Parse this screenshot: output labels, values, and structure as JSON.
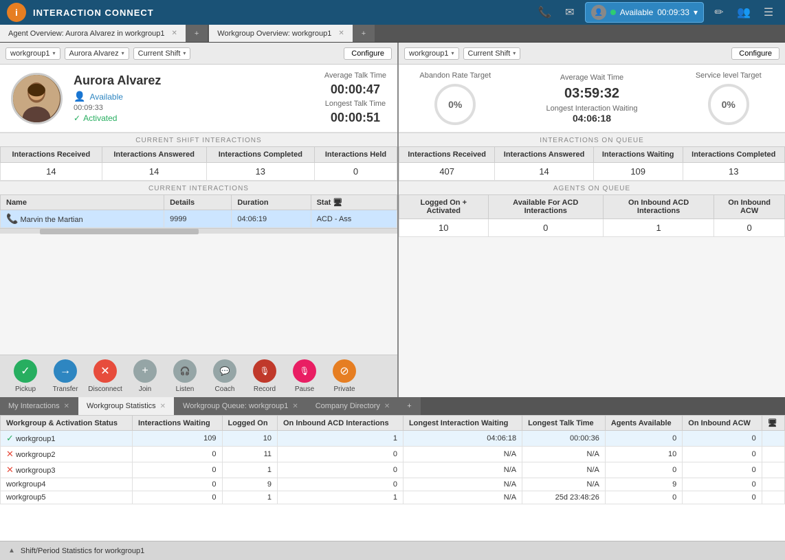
{
  "app": {
    "title": "INTERACTION CONNECT",
    "logo_char": "i"
  },
  "topnav": {
    "status": "Available",
    "timer": "00:09:33",
    "status_color": "#2ecc71"
  },
  "left_panel": {
    "tab_label": "Agent Overview: Aurora Alvarez in workgroup1",
    "workgroup_dropdown": "workgroup1",
    "agent_dropdown": "Aurora Alvarez",
    "period_dropdown": "Current Shift",
    "configure_label": "Configure",
    "agent": {
      "name": "Aurora Alvarez",
      "status": "Available",
      "time": "00:09:33",
      "activated": "Activated"
    },
    "avg_talk_label": "Average Talk Time",
    "avg_talk_value": "00:00:47",
    "longest_talk_label": "Longest Talk Time",
    "longest_talk_value": "00:00:51",
    "shift_section": "CURRENT SHIFT INTERACTIONS",
    "shift_stats": {
      "headers": [
        "Interactions Received",
        "Interactions Answered",
        "Interactions Completed",
        "Interactions Held"
      ],
      "values": [
        "14",
        "14",
        "13",
        "0"
      ]
    },
    "current_section": "CURRENT INTERACTIONS",
    "interactions_headers": [
      "Name",
      "Details",
      "Duration",
      "Stat"
    ],
    "interactions_rows": [
      {
        "name": "Marvin the Martian",
        "details": "9999",
        "duration": "04:06:19",
        "status": "ACD - Ass"
      }
    ],
    "actions": [
      {
        "id": "pickup",
        "label": "Pickup",
        "style": "btn-green",
        "icon": "✓"
      },
      {
        "id": "transfer",
        "label": "Transfer",
        "style": "btn-blue",
        "icon": "→"
      },
      {
        "id": "disconnect",
        "label": "Disconnect",
        "style": "btn-red",
        "icon": "✕"
      },
      {
        "id": "join",
        "label": "Join",
        "style": "btn-gray",
        "icon": "+"
      },
      {
        "id": "listen",
        "label": "Listen",
        "style": "btn-gray",
        "icon": "🎧"
      },
      {
        "id": "coach",
        "label": "Coach",
        "style": "btn-gray",
        "icon": "💬"
      },
      {
        "id": "record",
        "label": "Record",
        "style": "btn-dark-red",
        "icon": "🎙"
      },
      {
        "id": "pause",
        "label": "Pause",
        "style": "btn-pink",
        "icon": "🎙"
      },
      {
        "id": "private",
        "label": "Private",
        "style": "btn-orange",
        "icon": "⊘"
      }
    ]
  },
  "right_panel": {
    "tab_label": "Workgroup Overview: workgroup1",
    "workgroup_dropdown": "workgroup1",
    "period_dropdown": "Current Shift",
    "configure_label": "Configure",
    "abandon_rate_label": "Abandon Rate Target",
    "abandon_rate_value": "0%",
    "avg_wait_label": "Average Wait Time",
    "avg_wait_value": "03:59:32",
    "longest_wait_label": "Longest Interaction Waiting",
    "longest_wait_value": "04:06:18",
    "service_level_label": "Service level Target",
    "service_level_value": "0%",
    "queue_section": "INTERACTIONS ON QUEUE",
    "queue_headers": [
      "Interactions Received",
      "Interactions Answered",
      "Interactions Waiting",
      "Interactions Completed"
    ],
    "queue_values": [
      "407",
      "14",
      "109",
      "13"
    ],
    "agents_section": "AGENTS ON QUEUE",
    "agents_headers": [
      "Logged On + Activated",
      "Available For ACD Interactions",
      "On Inbound ACD Interactions",
      "On Inbound ACW"
    ],
    "agents_values": [
      "10",
      "0",
      "1",
      "0"
    ]
  },
  "bottom": {
    "tabs": [
      {
        "id": "my-interactions",
        "label": "My Interactions"
      },
      {
        "id": "workgroup-statistics",
        "label": "Workgroup Statistics",
        "active": true
      },
      {
        "id": "workgroup-queue",
        "label": "Workgroup Queue: workgroup1"
      },
      {
        "id": "company-directory",
        "label": "Company Directory"
      }
    ],
    "table_headers": [
      "Workgroup & Activation Status",
      "Interactions Waiting",
      "Logged On",
      "On Inbound ACD Interactions",
      "Longest Interaction Waiting",
      "Longest Talk Time",
      "Agents Available",
      "On Inbound ACW"
    ],
    "rows": [
      {
        "name": "workgroup1",
        "status": "check",
        "waiting": "109",
        "logged_on": "10",
        "acd": "1",
        "longest_waiting": "04:06:18",
        "longest_talk": "00:00:36",
        "available": "0",
        "acw": "0",
        "active": true
      },
      {
        "name": "workgroup2",
        "status": "x",
        "waiting": "0",
        "logged_on": "11",
        "acd": "0",
        "longest_waiting": "N/A",
        "longest_talk": "N/A",
        "available": "10",
        "acw": "0",
        "active": false
      },
      {
        "name": "workgroup3",
        "status": "x",
        "waiting": "0",
        "logged_on": "1",
        "acd": "0",
        "longest_waiting": "N/A",
        "longest_talk": "N/A",
        "available": "0",
        "acw": "0",
        "active": false
      },
      {
        "name": "workgroup4",
        "status": "none",
        "waiting": "0",
        "logged_on": "9",
        "acd": "0",
        "longest_waiting": "N/A",
        "longest_talk": "N/A",
        "available": "9",
        "acw": "0",
        "active": false
      },
      {
        "name": "workgroup5",
        "status": "none",
        "waiting": "0",
        "logged_on": "1",
        "acd": "1",
        "longest_waiting": "N/A",
        "longest_talk": "25d 23:48:26",
        "available": "0",
        "acw": "0",
        "active": false
      }
    ],
    "footer_label": "Shift/Period Statistics for workgroup1"
  }
}
